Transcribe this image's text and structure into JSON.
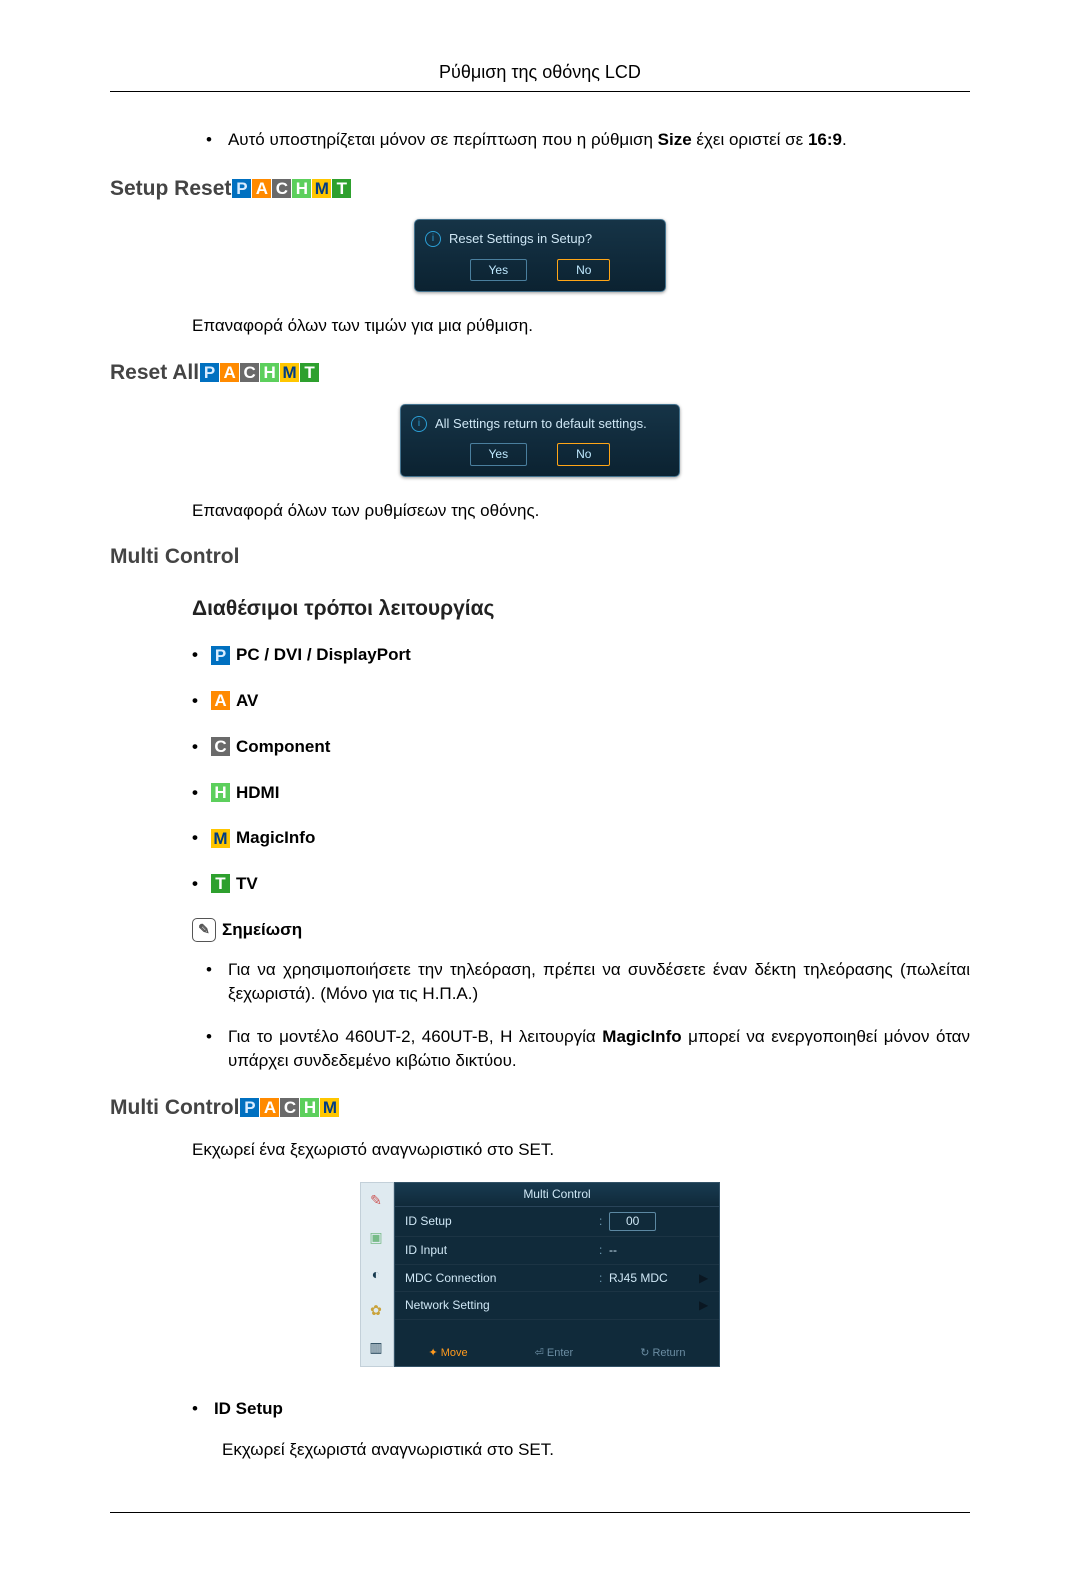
{
  "pageTitle": "Ρύθμιση της οθόνης LCD",
  "topBullet": {
    "pre": "Αυτό υποστηρίζεται μόνον σε περίπτωση που η ρύθμιση ",
    "bold1": "Size",
    "mid": " έχει οριστεί σε ",
    "bold2": "16:9",
    "post": "."
  },
  "badges": {
    "P": "P",
    "A": "A",
    "C": "C",
    "H": "H",
    "M": "M",
    "T": "T"
  },
  "setupReset": {
    "heading": "Setup Reset",
    "dialogMsg": "Reset Settings in Setup?",
    "yes": "Yes",
    "no": "No",
    "desc": "Επαναφορά όλων των τιμών για μια ρύθμιση."
  },
  "resetAll": {
    "heading": "Reset All",
    "dialogMsg": "All Settings return to default settings.",
    "yes": "Yes",
    "no": "No",
    "desc": "Επαναφορά όλων των ρυθμίσεων της οθόνης."
  },
  "multiControl1": {
    "heading": "Multi Control",
    "sub": "Διαθέσιμοι τρόποι λειτουργίας",
    "modes": [
      {
        "badge": "P",
        "label": "PC / DVI / DisplayPort"
      },
      {
        "badge": "A",
        "label": "AV"
      },
      {
        "badge": "C",
        "label": "Component"
      },
      {
        "badge": "H",
        "label": "HDMI"
      },
      {
        "badge": "M",
        "label": "MagicInfo"
      },
      {
        "badge": "T",
        "label": "TV"
      }
    ],
    "noteLabel": "Σημείωση",
    "notes": [
      "Για να χρησιμοποιήσετε την τηλεόραση, πρέπει να συνδέσετε έναν δέκτη τηλεόρασης (πωλείται ξεχωριστά). (Μόνο για τις Η.Π.Α.)",
      {
        "pre": "Για το μοντέλο 460UT-2, 460UT-B, Η λειτουργία ",
        "bold": "MagicInfo",
        "post": " μπορεί να ενεργοποιηθεί μόνον όταν υπάρχει συνδεδεμένο κιβώτιο δικτύου."
      }
    ]
  },
  "multiControl2": {
    "heading": "Multi Control",
    "desc": "Εκχωρεί ένα ξεχωριστό αναγνωριστικό στο SET.",
    "menuTitle": "Multi Control",
    "rows": {
      "idSetup": {
        "lbl": "ID Setup",
        "val": "00"
      },
      "idInput": {
        "lbl": "ID Input",
        "val": "--"
      },
      "mdc": {
        "lbl": "MDC Connection",
        "val": "RJ45 MDC"
      },
      "net": {
        "lbl": "Network Setting",
        "val": ""
      }
    },
    "footer": {
      "move": "Move",
      "enter": "Enter",
      "ret": "Return"
    },
    "idSetupTitle": "ID Setup",
    "idSetupDesc": "Εκχωρεί ξεχωριστά αναγνωριστικά στο SET."
  }
}
